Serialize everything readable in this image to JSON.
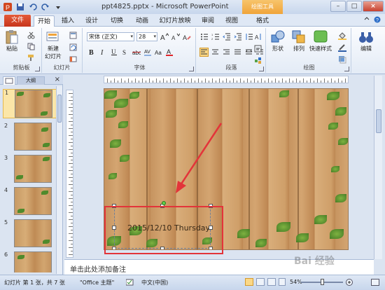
{
  "window": {
    "title": "ppt4825.pptx - Microsoft PowerPoint",
    "context_tab_title": "绘图工具",
    "minimize": "–",
    "maximize": "□",
    "close": "×"
  },
  "tabs": {
    "file": "文件",
    "items": [
      "开始",
      "插入",
      "设计",
      "切换",
      "动画",
      "幻灯片放映",
      "审阅",
      "视图",
      "格式"
    ],
    "active": "开始"
  },
  "ribbon": {
    "clipboard": {
      "label": "剪贴板",
      "paste": "粘贴"
    },
    "slides": {
      "label": "幻灯片",
      "new_slide_line1": "新建",
      "new_slide_line2": "幻灯片"
    },
    "font": {
      "label": "字体",
      "font_name": "宋体 (正文)",
      "font_size": "28"
    },
    "paragraph": {
      "label": "段落"
    },
    "drawing": {
      "label": "绘图",
      "shapes": "形状",
      "arrange": "排列",
      "quick_styles": "快速样式"
    },
    "editing": {
      "label": "编辑",
      "edit": "编辑"
    }
  },
  "outline_tab": "大纲",
  "slide_numbers": [
    "1",
    "2",
    "3",
    "4",
    "5",
    "6"
  ],
  "slide": {
    "date_text": "2015/12/10  Thursday"
  },
  "notes": {
    "placeholder": "单击此处添加备注"
  },
  "statusbar": {
    "slide_info": "幻灯片 第 1 张，共 7 张",
    "theme": "\"Office 主题\"",
    "language": "中文(中国)",
    "zoom": "54%"
  },
  "watermark": "Bai 经验",
  "colors": {
    "accent": "#e3343a",
    "ribbon_bg": "#fbfcfe",
    "file_tab": "#c7351b",
    "context_tab": "#f0a43a"
  }
}
